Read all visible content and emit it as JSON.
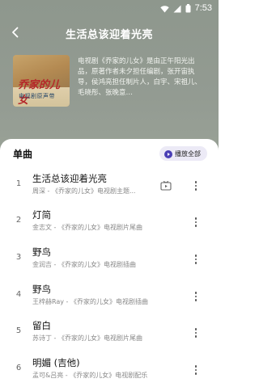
{
  "status_bar": {
    "time": "7:53"
  },
  "header": {
    "title": "生活总该迎着光亮"
  },
  "album": {
    "cover_title": "乔家的儿女",
    "cover_subtitle": "电视剧原声带",
    "description": "电视剧《乔家的儿女》是由正午阳光出品，原著作者未夕担任编剧，张开宙执导，侯鸿亮担任制片人，白宇、宋祖儿、毛晓彤、张晚意…"
  },
  "list": {
    "title": "单曲",
    "play_all_label": "播放全部",
    "songs": [
      {
        "index": "1",
        "name": "生活总该迎着光亮",
        "meta": "周深 - 《乔家的儿女》电视剧主题...",
        "has_mv": true
      },
      {
        "index": "2",
        "name": "灯简",
        "meta": "金志文 - 《乔家的儿女》电视剧片尾曲"
      },
      {
        "index": "3",
        "name": "野鸟",
        "meta": "金润吉 - 《乔家的儿女》电视剧插曲"
      },
      {
        "index": "4",
        "name": "野鸟",
        "meta": "王梓赫Ray - 《乔家的儿女》电视剧插曲"
      },
      {
        "index": "5",
        "name": "留白",
        "meta": "苏诗丁 - 《乔家的儿女》电视剧片尾曲"
      },
      {
        "index": "6",
        "name": "明媚 (吉他)",
        "meta": "孟可&吕亮 - 《乔家的儿女》电视剧配乐"
      }
    ]
  },
  "colors": {
    "header_bg": "#939b92",
    "accent": "#4a3fb5",
    "play_all_bg": "#eceaf6"
  }
}
